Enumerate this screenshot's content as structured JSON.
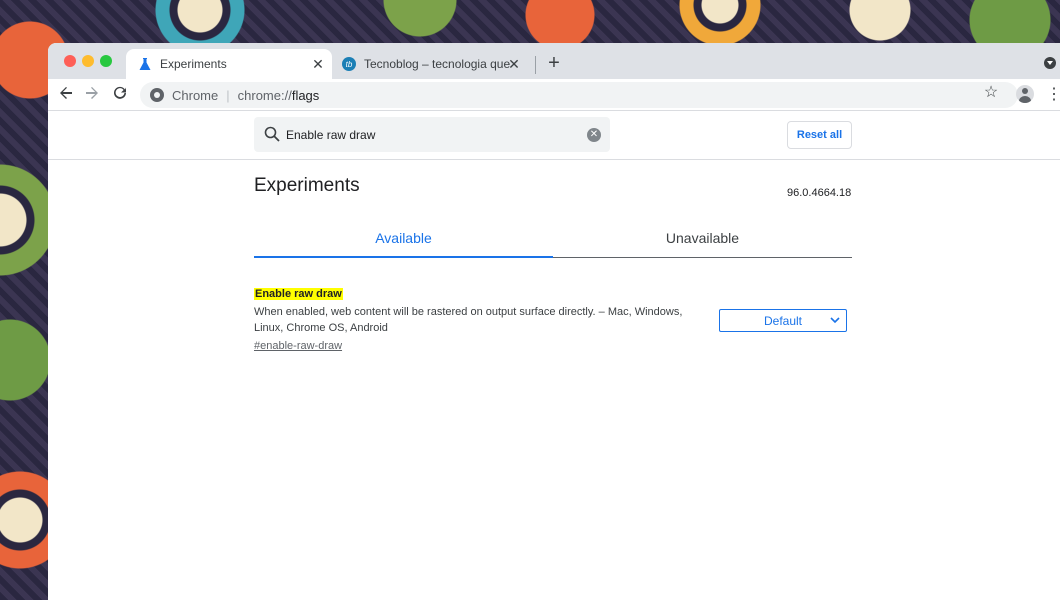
{
  "tabs": [
    {
      "title": "Experiments",
      "active": true,
      "icon": "flask-icon"
    },
    {
      "title": "Tecnoblog – tecnologia que interessa",
      "active": false,
      "icon": "tecnoblog-favicon"
    }
  ],
  "toolbar": {
    "chip": "Chrome",
    "url_scheme": "chrome://",
    "url_host": "flags"
  },
  "flags": {
    "search_value": "Enable raw draw",
    "reset_label": "Reset all",
    "page_title": "Experiments",
    "version": "96.0.4664.18",
    "tab_available": "Available",
    "tab_unavailable": "Unavailable",
    "items": [
      {
        "title": "Enable raw draw",
        "description": "When enabled, web content will be rastered on output surface directly. – Mac, Windows, Linux, Chrome OS, Android",
        "link": "#enable-raw-draw",
        "selected": "Default"
      }
    ]
  },
  "colors": {
    "accent": "#1a73e8",
    "highlight": "#ffff00"
  }
}
